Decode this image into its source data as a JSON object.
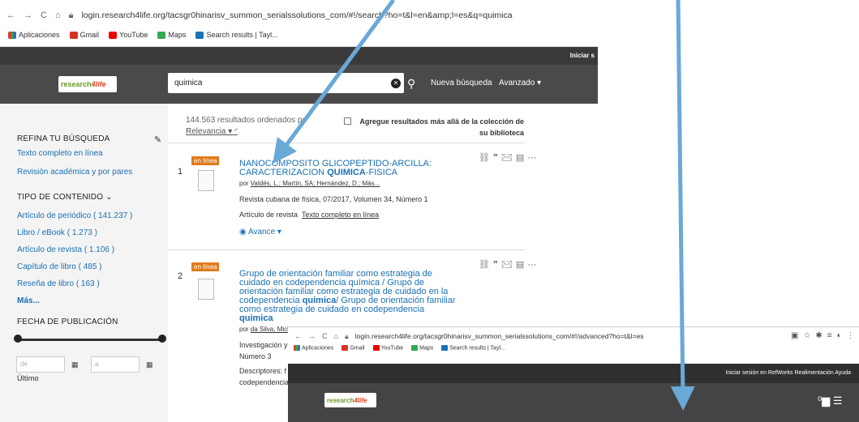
{
  "browser1": {
    "nav_symbols": [
      "←",
      "→",
      "C",
      "⌂"
    ],
    "url": "login.research4life.org/tacsgr0hinarisv_summon_serialssolutions_com/#!/search?ho=t&l=en&amp;l=es&q=quimica",
    "bookmarks": [
      "Aplicaciones",
      "Gmail",
      "YouTube",
      "Maps",
      "Search results | Tayl..."
    ]
  },
  "app": {
    "topbar_text": "Iniciar s",
    "logo_text": "research",
    "logo_accent": "4life",
    "search_value": "quimica",
    "new_search": "Nueva búsqueda",
    "advanced": "Avanzado ▾"
  },
  "sidebar": {
    "refine_title": "REFINA TU BÚSQUEDA",
    "fulltext": "Texto completo en línea",
    "peer": "Revisión académica y por pares",
    "content_type_title": "TIPO DE CONTENIDO ⌄",
    "types": [
      "Artículo de periódico ( 141.237 )",
      "Libro / eBook ( 1.273 )",
      "Artículo de revista ( 1.106 )",
      "Capítulo de libro ( 485 )",
      "Reseña de libro ( 163 )"
    ],
    "more": "Más...",
    "pubdate_title": "FECHA DE PUBLICACIÓN",
    "from_placeholder": "de",
    "to_placeholder": "a",
    "last": "Último"
  },
  "results": {
    "count_text": "144.563 resultados ordenados po",
    "relevance": "Relevancia ▾",
    "beyond_label": "Agregue resultados más allá de la colección de su biblioteca",
    "items": [
      {
        "number": "1",
        "badge": "en línea",
        "title_line1": "NANOCOMPOSITO GLICOPEPTIDO-ARCILLA:",
        "title_line2_pre": "CARACTERIZACION ",
        "title_line2_bold": "QUIMICA",
        "title_line2_post": "-FISICA",
        "authors_prefix": "por ",
        "authors": "Valdés, L.; Martín, SA; Hernández, D.; Más...",
        "source": "Revista cubana de física, 07/2017, Volumen 34, Número 1",
        "type": "Artículo de revista",
        "fulltext": "Texto completo en línea",
        "advance": "Avance ▾"
      },
      {
        "number": "2",
        "badge": "en línea",
        "title_lines": [
          "Grupo de orientación familiar como estrategia de",
          "cuidado en codependencia química / Grupo de",
          "orientación familiar como estrategia de cuidado en la",
          "codependencia ",
          "como estrategia de cuidado en codependencia"
        ],
        "title_bold_a": "quimica",
        "title_line4_post": "/ Grupo de orientación familiar",
        "title_bold_b": "quimica",
        "authors_prefix": "por ",
        "authors": "da Silva, Mich",
        "source_a": "Investigación y",
        "source_b": "Número 3",
        "descriptors": "Descriptores: f",
        "descriptors2": "codependencia"
      }
    ]
  },
  "browser2": {
    "nav_symbols": [
      "←",
      "→",
      "C",
      "⌂"
    ],
    "url": "login.research4life.org/tacsgr0hinarisv_summon_serialssolutions_com/#!/advanced?ho=t&l=es",
    "bookmarks": [
      "Aplicaciones",
      "Gmail",
      "YouTube",
      "Maps",
      "Search results | Tayl..."
    ],
    "topbar_text": "Iniciar sesión en RefWorks   Realimentación   Ayuda",
    "logo_text": "research",
    "logo_accent": "4life",
    "menu_icons": "⁰▆ ☰"
  },
  "colors": {
    "link": "#1a6fb4",
    "badge": "#e07b1a",
    "header": "#4a4a4a",
    "arrow": "#6aa8d8"
  }
}
